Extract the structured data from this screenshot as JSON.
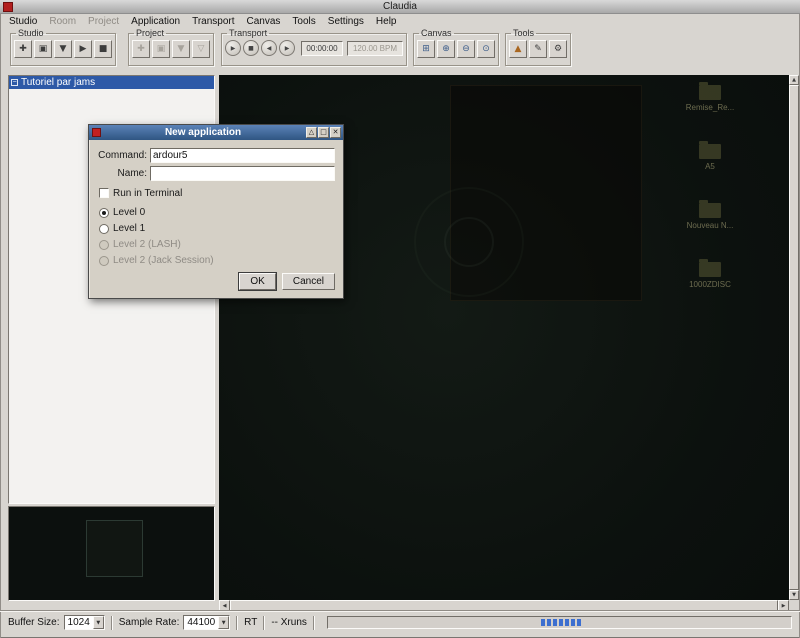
{
  "window": {
    "title": "Claudia"
  },
  "menubar": {
    "items": [
      {
        "label": "Studio",
        "enabled": true
      },
      {
        "label": "Room",
        "enabled": false
      },
      {
        "label": "Project",
        "enabled": false
      },
      {
        "label": "Application",
        "enabled": true
      },
      {
        "label": "Transport",
        "enabled": true
      },
      {
        "label": "Canvas",
        "enabled": true
      },
      {
        "label": "Tools",
        "enabled": true
      },
      {
        "label": "Settings",
        "enabled": true
      },
      {
        "label": "Help",
        "enabled": true
      }
    ]
  },
  "toolbar": {
    "studio_group": {
      "label": "Studio",
      "buttons": [
        {
          "name": "studio-new",
          "glyph": "✚"
        },
        {
          "name": "studio-load",
          "glyph": "▣"
        },
        {
          "name": "studio-save",
          "glyph": "▼"
        },
        {
          "name": "studio-start",
          "glyph": "▶"
        },
        {
          "name": "studio-stop",
          "glyph": "■"
        }
      ]
    },
    "project_group": {
      "label": "Project",
      "enabled": false,
      "buttons": [
        {
          "name": "project-new",
          "glyph": "✚"
        },
        {
          "name": "project-load",
          "glyph": "▣"
        },
        {
          "name": "project-save",
          "glyph": "▼"
        },
        {
          "name": "project-save-as",
          "glyph": "▽"
        }
      ]
    },
    "transport_group": {
      "label": "Transport",
      "buttons": [
        {
          "name": "transport-play",
          "glyph": "▶"
        },
        {
          "name": "transport-stop",
          "glyph": "■"
        },
        {
          "name": "transport-backwards",
          "glyph": "◀"
        },
        {
          "name": "transport-forwards",
          "glyph": "▶"
        }
      ],
      "time": "00:00:00",
      "bpm": "120.00 BPM"
    },
    "canvas_group": {
      "label": "Canvas",
      "buttons": [
        {
          "name": "zoom-fit",
          "glyph": "⊞"
        },
        {
          "name": "zoom-in",
          "glyph": "⊕"
        },
        {
          "name": "zoom-out",
          "glyph": "⊖"
        },
        {
          "name": "zoom-100",
          "glyph": "⊙"
        }
      ]
    },
    "tools_group": {
      "label": "Tools",
      "buttons": [
        {
          "name": "tool-configure",
          "glyph": "▲"
        },
        {
          "name": "tool-render",
          "glyph": "✎"
        },
        {
          "name": "tool-settings",
          "glyph": "⚙"
        }
      ]
    }
  },
  "studio_list": {
    "expander_glyph": "−",
    "items": [
      {
        "label": "Tutoriel par jams",
        "selected": true
      }
    ]
  },
  "dialog": {
    "title": "New application",
    "titlebar_buttons": [
      {
        "name": "shade",
        "glyph": "△"
      },
      {
        "name": "maximize",
        "glyph": "□"
      },
      {
        "name": "close",
        "glyph": "✕"
      }
    ],
    "command_label": "Command:",
    "command_value": "ardour5",
    "name_label": "Name:",
    "name_value": "",
    "terminal_label": "Run in Terminal",
    "levels": [
      {
        "label": "Level 0",
        "selected": true,
        "enabled": true
      },
      {
        "label": "Level 1",
        "selected": false,
        "enabled": true
      },
      {
        "label": "Level 2 (LASH)",
        "selected": false,
        "enabled": false
      },
      {
        "label": "Level 2 (Jack Session)",
        "selected": false,
        "enabled": false
      }
    ],
    "ok_label": "OK",
    "cancel_label": "Cancel"
  },
  "statusbar": {
    "buffer_size_label": "Buffer Size:",
    "buffer_size_value": "1024",
    "sample_rate_label": "Sample Rate:",
    "sample_rate_value": "44100",
    "rt_label": "RT",
    "xruns_label": "-- Xruns"
  },
  "desktop_icons": {
    "items": [
      {
        "label": "Remise_Re..."
      },
      {
        "label": "A5"
      },
      {
        "label": "Nouveau N..."
      },
      {
        "label": "1000ZDISC"
      }
    ]
  },
  "icons": {
    "arrow_up": "▲",
    "arrow_down": "▼",
    "arrow_left": "◀",
    "arrow_right": "▶"
  },
  "colors": {
    "selection": "#2d59a7",
    "dialog_title_from": "#5b82b8",
    "dialog_title_to": "#2f5582",
    "meter_blue": "#3c6fd0",
    "canvas_bg": "#0c110e"
  }
}
